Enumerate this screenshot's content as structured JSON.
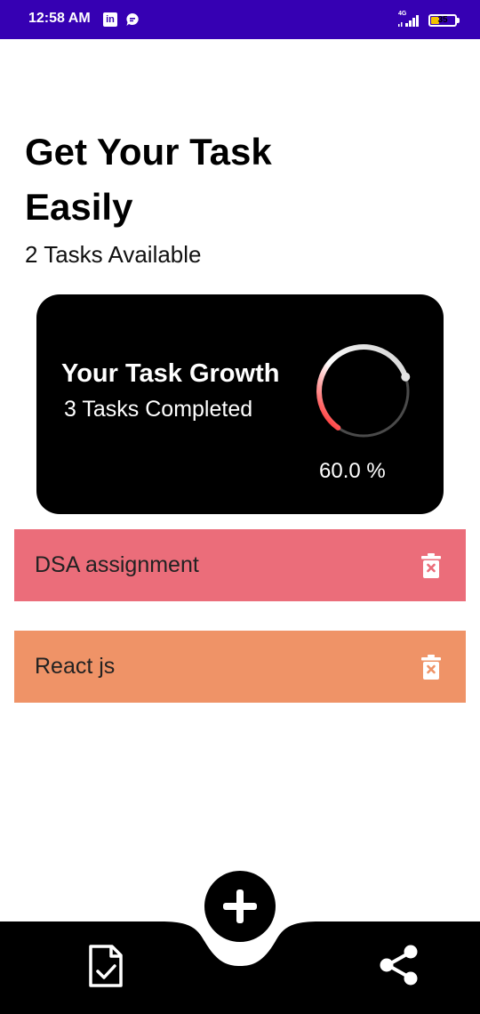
{
  "status_bar": {
    "time": "12:58 AM",
    "network": "4G",
    "battery": "35",
    "battery_level": 0.35,
    "icons": [
      "linkedin-icon",
      "message-icon",
      "signal-icon",
      "battery-icon"
    ]
  },
  "header": {
    "title": "Get Your Task Easily",
    "subtitle": "2 Tasks Available"
  },
  "growth_card": {
    "title": "Your Task Growth",
    "completed_text": "3 Tasks Completed",
    "progress_value": 0.6,
    "progress_label": "60.0 %",
    "colors": {
      "background": "#000000",
      "ring_start": "#ff1a1a",
      "ring_end": "#ffffff"
    }
  },
  "tasks": [
    {
      "name": "DSA assignment",
      "color": "#eb6d7a",
      "icon": "delete-icon"
    },
    {
      "name": "React js",
      "color": "#ef9367",
      "icon": "delete-icon"
    }
  ],
  "bottom_nav": {
    "left_icon": "task-document-icon",
    "fab_icon": "plus-icon",
    "right_icon": "share-icon"
  },
  "colors": {
    "status_bar": "#3600b3",
    "nav_bar": "#000000",
    "page_background": "#ffffff"
  }
}
